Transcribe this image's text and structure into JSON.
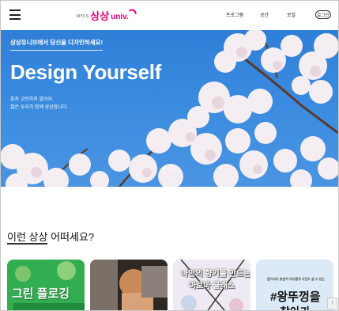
{
  "header": {
    "logo_small": "MYCS",
    "logo_main": "상상",
    "logo_univ": "univ.",
    "nav": [
      {
        "label": "프로그램"
      },
      {
        "label": "공간"
      },
      {
        "label": "로컬"
      }
    ],
    "login_label": "로그인"
  },
  "hero": {
    "subtitle": "상상유니브에서 당신을 디자인하세요!",
    "title": "Design Yourself",
    "desc_line1": "혼자 고민하지 말아요.",
    "desc_line2": "젊은 우리가 함께 상상합니다.",
    "slides": 2,
    "active_slide": 1
  },
  "section": {
    "title_highlight": "이런 상상",
    "title_rest": " 어떠세요?"
  },
  "cards": [
    {
      "text": "그린 플로깅",
      "bg": "#2fa84f"
    },
    {
      "text": "",
      "bg": "#3a3430"
    },
    {
      "text": "나만의 향기를 만드는 아로마 클래스",
      "line1": "나만의 향기를 만드는",
      "line2": "아로마 클래스",
      "bg": "#e9e4f0"
    },
    {
      "small": "혼자서도 충분히 자유롭게 사진도 살 수 있는",
      "text": "#왕뚜껑을",
      "text2": "찾아가 .",
      "bg": "#dbeaf6"
    }
  ],
  "scroll_top_icon": "arrow-up-icon",
  "colors": {
    "brand": "#e6007e",
    "sky": "#3a8be0"
  }
}
